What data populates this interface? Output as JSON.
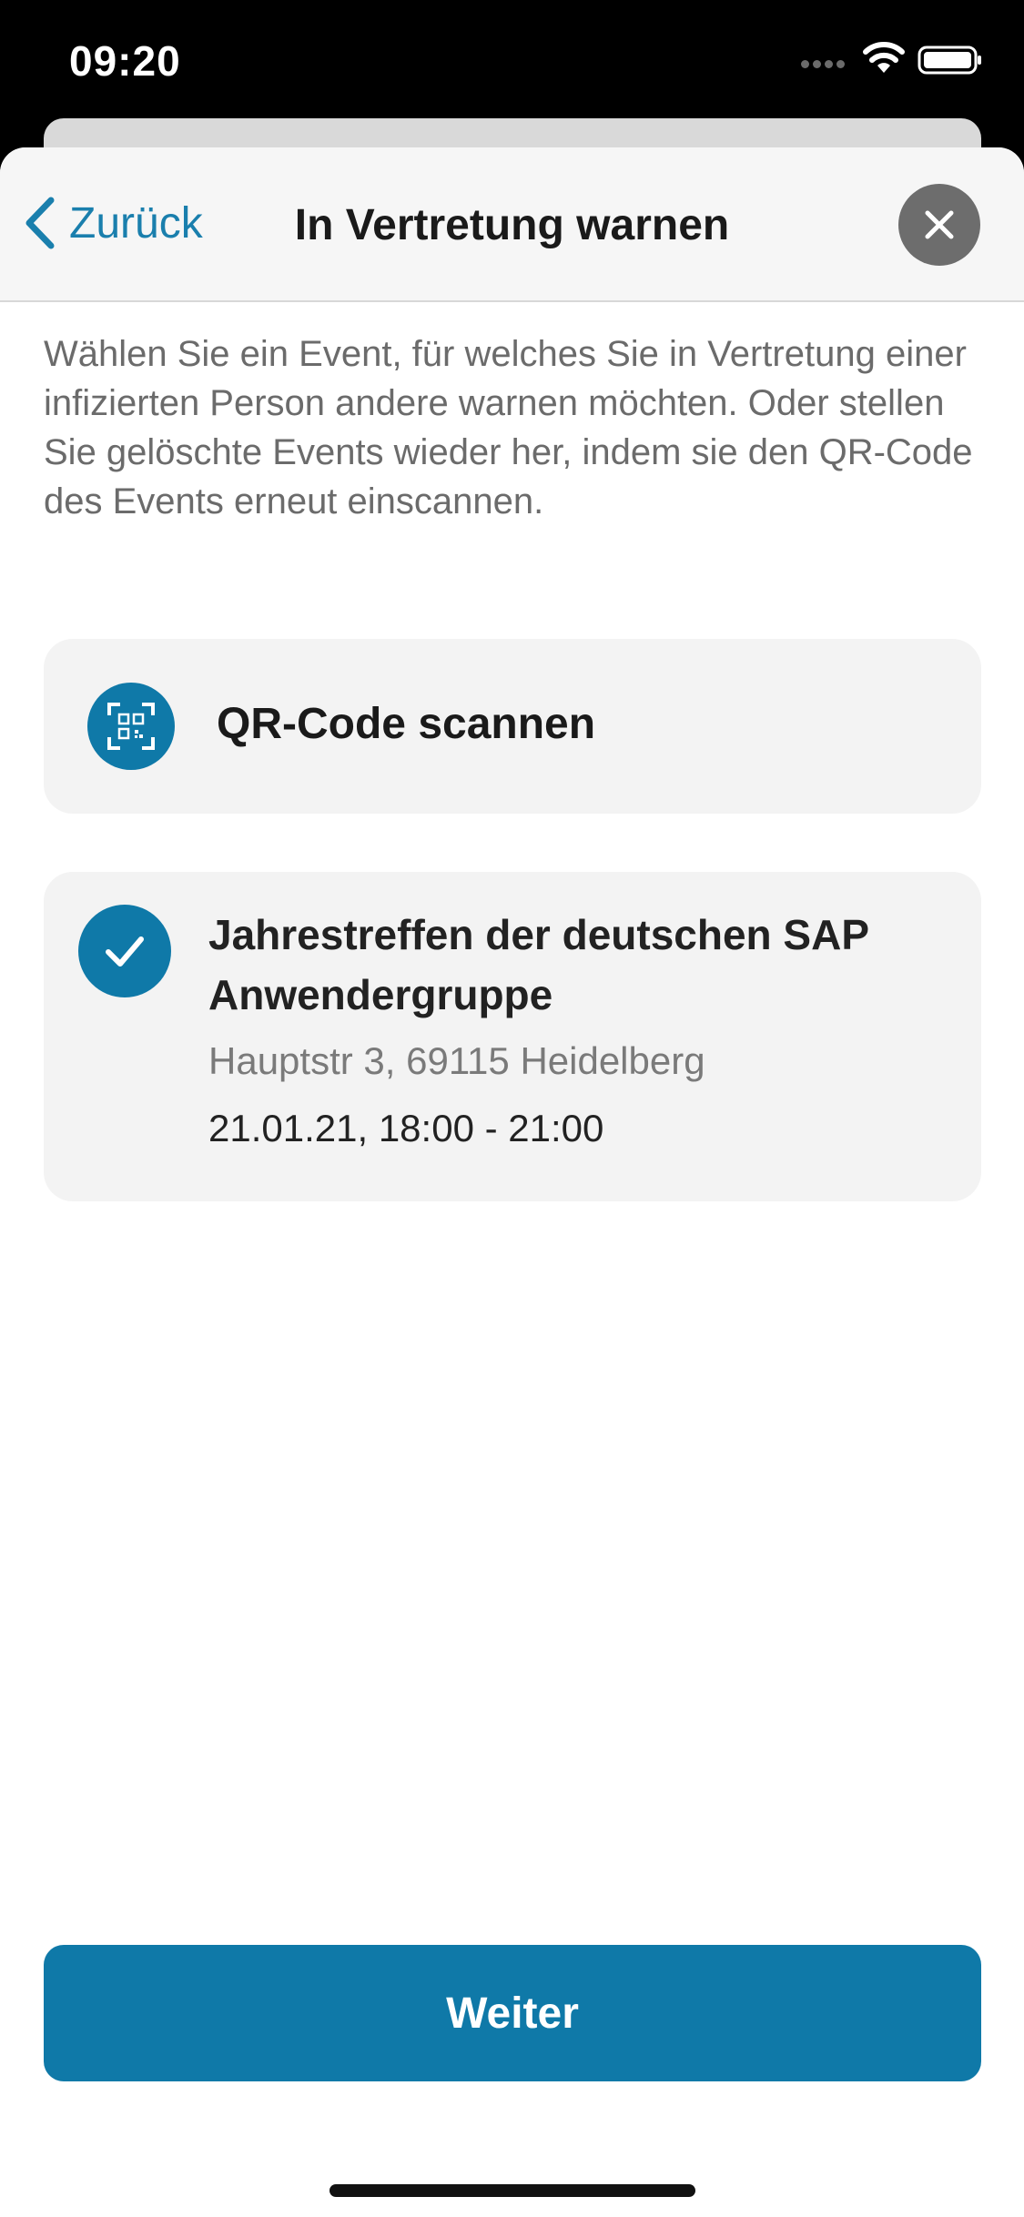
{
  "status_bar": {
    "time": "09:20"
  },
  "nav": {
    "back_label": "Zurück",
    "title": "In Vertretung warnen"
  },
  "intro_text": "Wählen Sie ein Event, für welches Sie in Vertretung einer infizierten Person andere warnen möchten. Oder stellen Sie gelöschte Events wieder her, indem sie den QR-Code des Events erneut einscannen.",
  "qr_scan": {
    "label": "QR-Code scannen",
    "icon": "qr-code-scan-icon"
  },
  "event": {
    "selected": true,
    "title": "Jahrestreffen der deutschen SAP Anwendergruppe",
    "address": "Hauptstr 3, 69115 Heidelberg",
    "time": "21.01.21, 18:00 - 21:00"
  },
  "continue_button": {
    "label": "Weiter"
  },
  "colors": {
    "accent": "#0f79a8",
    "link": "#1a7fad",
    "card_background": "#f3f3f3",
    "secondary_text": "#6b6b6b"
  }
}
